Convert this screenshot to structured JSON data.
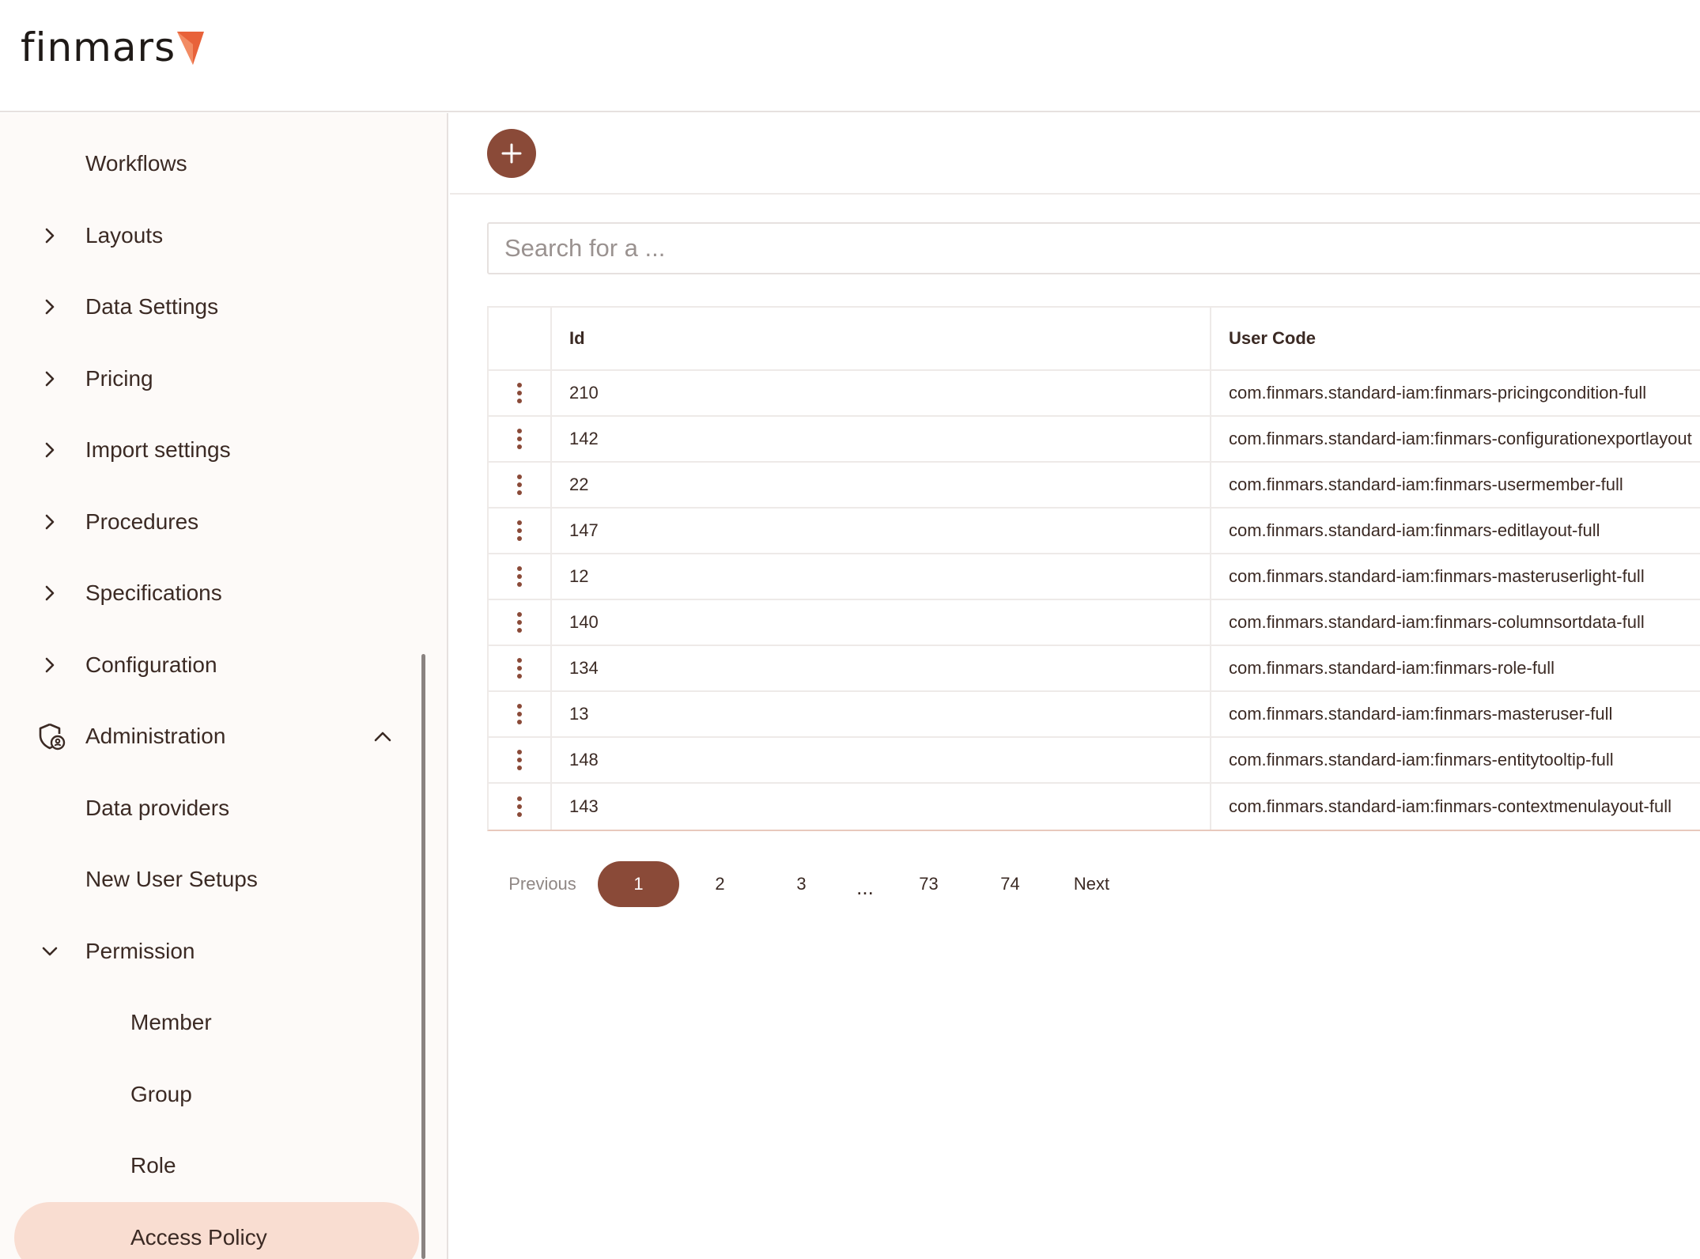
{
  "app": {
    "logo_text": "finmars",
    "logo_color": "#e8623a"
  },
  "sidebar": {
    "items": [
      {
        "label": "Workflows",
        "chevron": "none"
      },
      {
        "label": "Layouts",
        "chevron": "right"
      },
      {
        "label": "Data Settings",
        "chevron": "right"
      },
      {
        "label": "Pricing",
        "chevron": "right"
      },
      {
        "label": "Import settings",
        "chevron": "right"
      },
      {
        "label": "Procedures",
        "chevron": "right"
      },
      {
        "label": "Specifications",
        "chevron": "right"
      },
      {
        "label": "Configuration",
        "chevron": "right"
      }
    ],
    "administration": {
      "label": "Administration",
      "icon": "shield-user-icon",
      "expanded": true,
      "children": [
        {
          "label": "Data providers"
        },
        {
          "label": "New User Setups"
        }
      ],
      "permission": {
        "label": "Permission",
        "expanded": true,
        "children": [
          {
            "label": "Member"
          },
          {
            "label": "Group"
          },
          {
            "label": "Role"
          },
          {
            "label": "Access Policy",
            "active": true
          }
        ]
      }
    }
  },
  "toolbar": {
    "add_icon": "plus-icon"
  },
  "search": {
    "placeholder": "Search for a ...",
    "value": ""
  },
  "table": {
    "columns": [
      "Id",
      "User Code"
    ],
    "rows": [
      {
        "id": "210",
        "user_code": "com.finmars.standard-iam:finmars-pricingcondition-full"
      },
      {
        "id": "142",
        "user_code": "com.finmars.standard-iam:finmars-configurationexportlayout"
      },
      {
        "id": "22",
        "user_code": "com.finmars.standard-iam:finmars-usermember-full"
      },
      {
        "id": "147",
        "user_code": "com.finmars.standard-iam:finmars-editlayout-full"
      },
      {
        "id": "12",
        "user_code": "com.finmars.standard-iam:finmars-masteruserlight-full"
      },
      {
        "id": "140",
        "user_code": "com.finmars.standard-iam:finmars-columnsortdata-full"
      },
      {
        "id": "134",
        "user_code": "com.finmars.standard-iam:finmars-role-full"
      },
      {
        "id": "13",
        "user_code": "com.finmars.standard-iam:finmars-masteruser-full"
      },
      {
        "id": "148",
        "user_code": "com.finmars.standard-iam:finmars-entitytooltip-full"
      },
      {
        "id": "143",
        "user_code": "com.finmars.standard-iam:finmars-contextmenulayout-full"
      }
    ]
  },
  "pagination": {
    "previous": "Previous",
    "pages": [
      "1",
      "2",
      "3"
    ],
    "ellipsis": "...",
    "tail_pages": [
      "73",
      "74"
    ],
    "next": "Next",
    "current": "1"
  },
  "colors": {
    "accent": "#8a4a38",
    "active_bg": "#f9ddd1",
    "text": "#3b2a24"
  }
}
